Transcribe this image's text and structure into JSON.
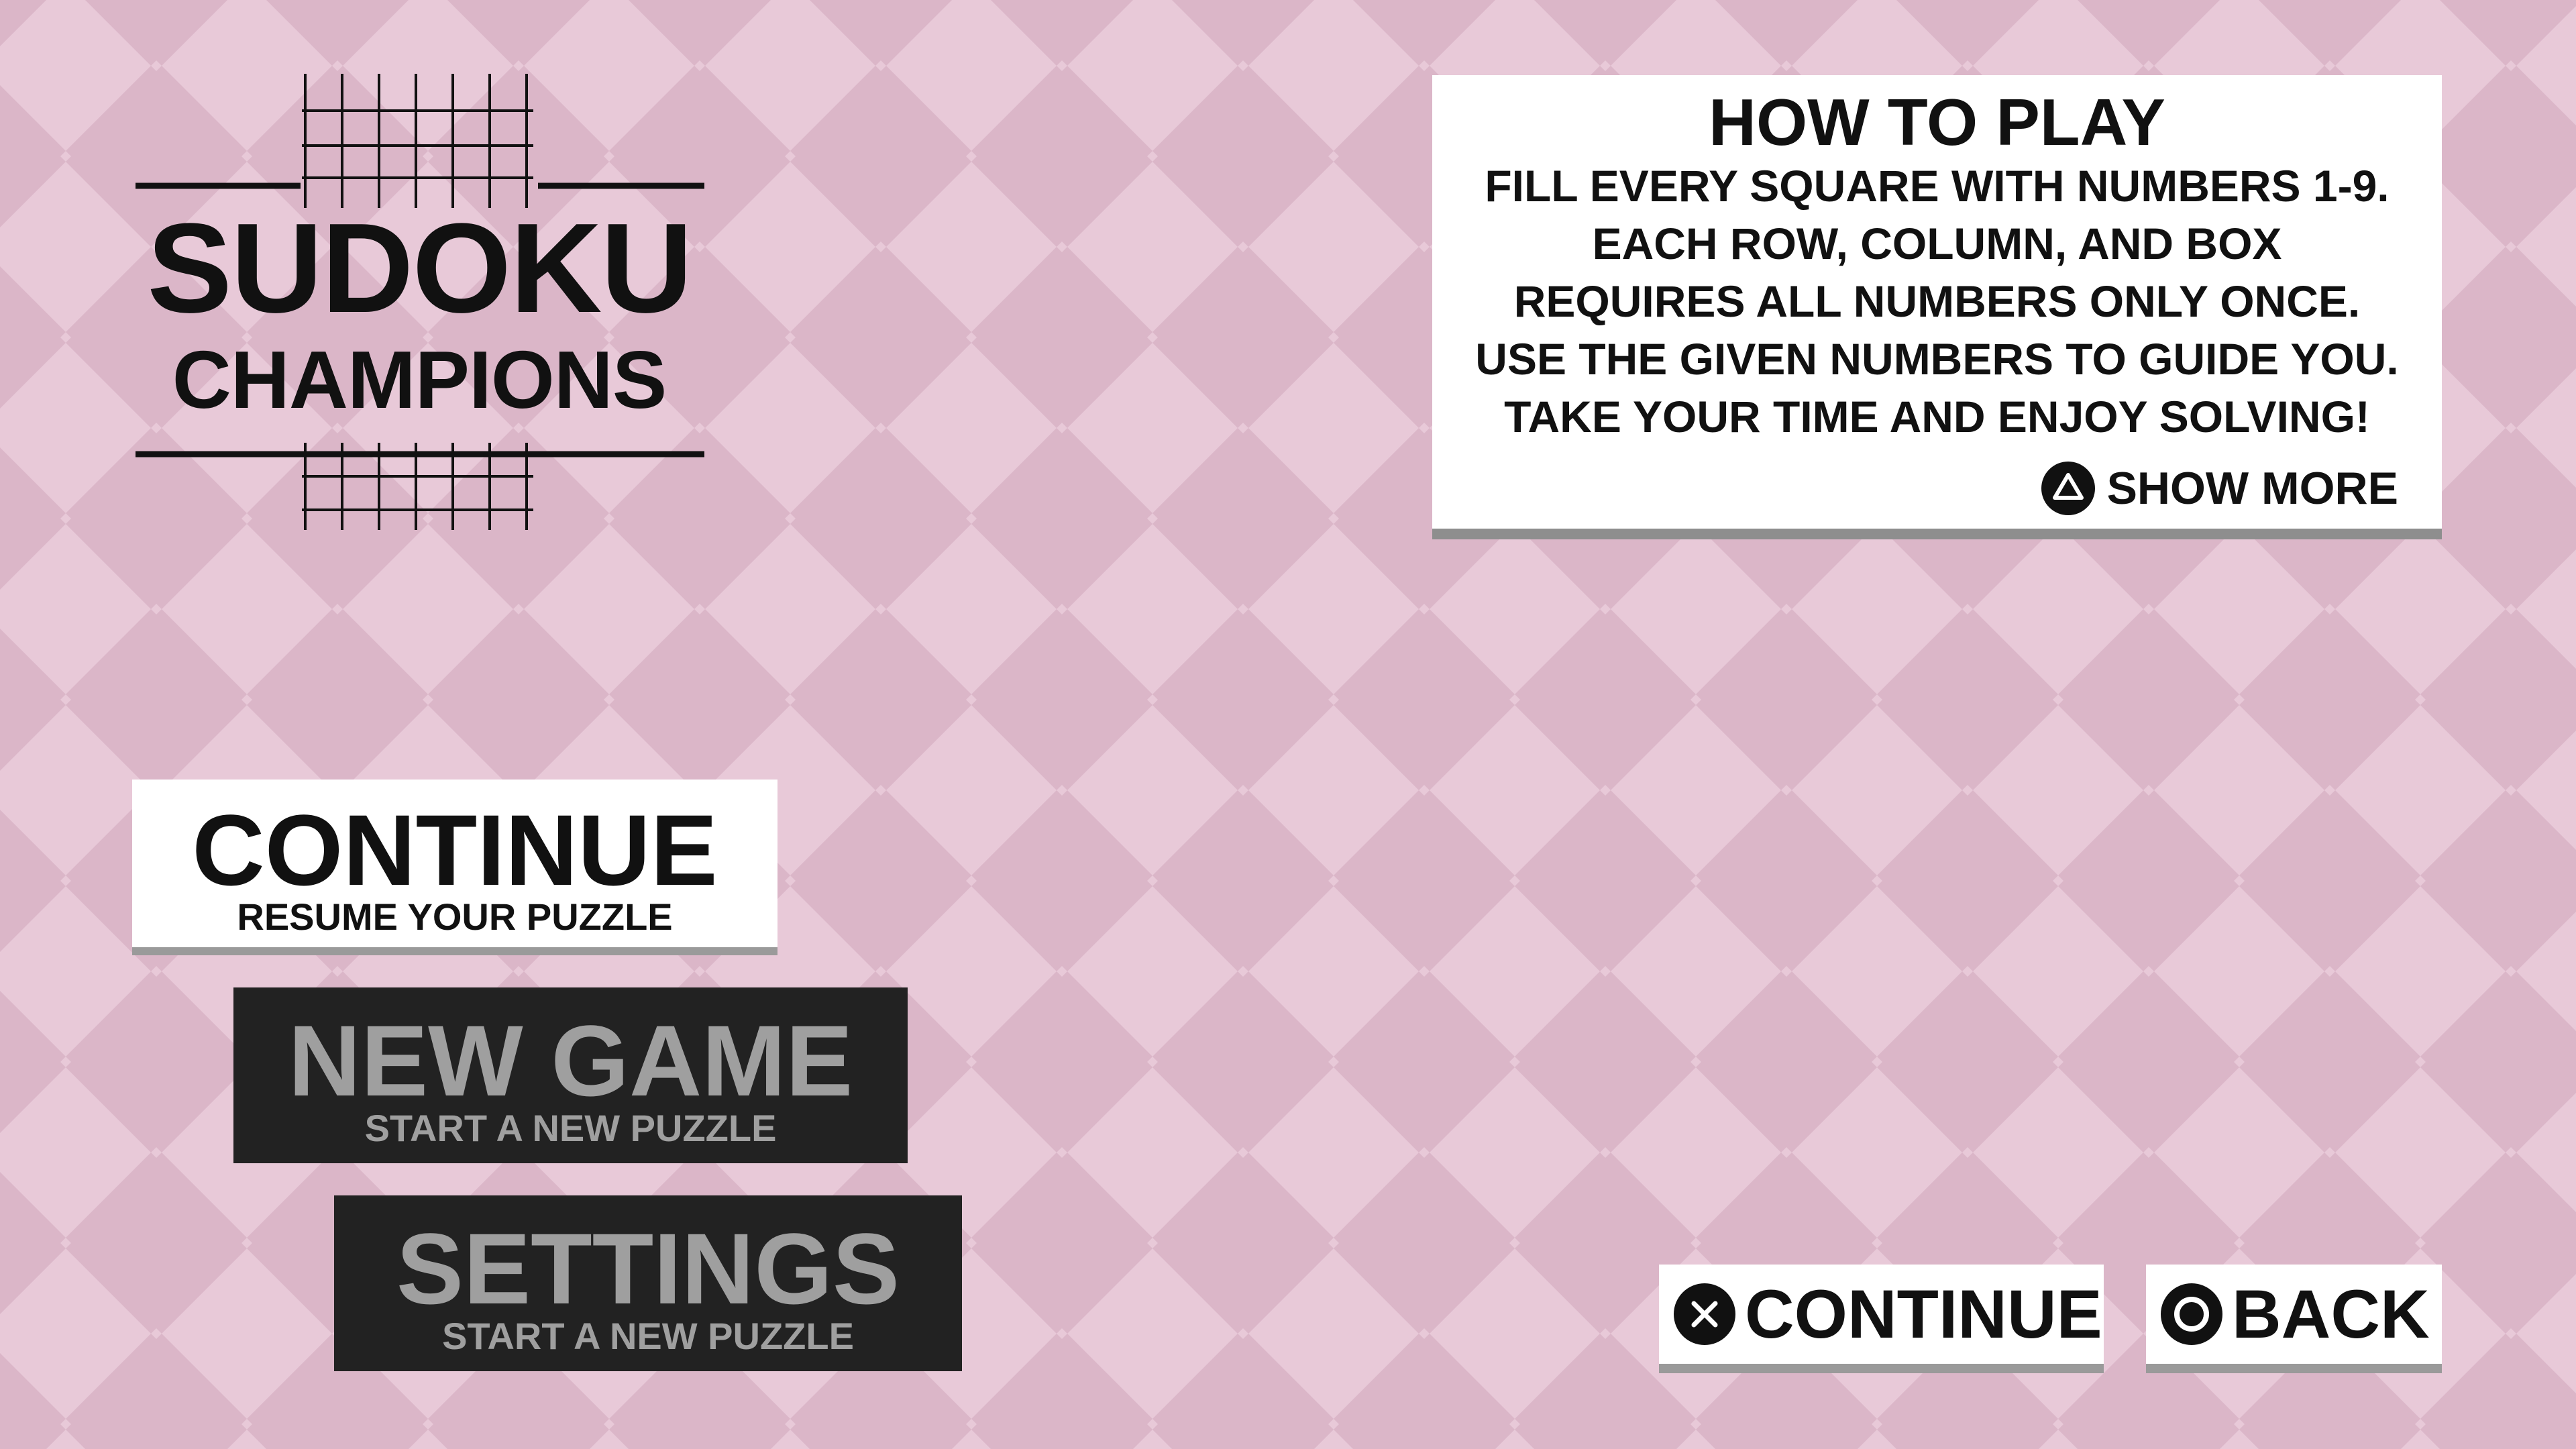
{
  "colors": {
    "background": "#dfbccd",
    "tile_light": "#e9cbd9",
    "panel": "#ffffff",
    "button_dark": "#222222",
    "button_dark_text": "#9f9f9f",
    "text": "#111111"
  },
  "logo": {
    "line1": "SUDOKU",
    "line2": "CHAMPIONS"
  },
  "how_to_play": {
    "title": "HOW TO PLAY",
    "lines": [
      "FILL EVERY SQUARE WITH NUMBERS 1-9.",
      "EACH ROW, COLUMN, AND BOX",
      "REQUIRES ALL NUMBERS ONLY ONCE.",
      "USE THE GIVEN NUMBERS TO GUIDE YOU.",
      "TAKE YOUR TIME AND ENJOY SOLVING!"
    ],
    "show_more": {
      "icon": "triangle-button-icon",
      "label": "SHOW MORE"
    }
  },
  "menu": {
    "continue": {
      "label": "CONTINUE",
      "sub": "RESUME YOUR PUZZLE",
      "selected": true
    },
    "new_game": {
      "label": "NEW GAME",
      "sub": "START A NEW PUZZLE",
      "selected": false
    },
    "settings": {
      "label": "SETTINGS",
      "sub": "START A NEW PUZZLE",
      "selected": false
    }
  },
  "prompts": {
    "continue": {
      "icon": "cross-button-icon",
      "label": "CONTINUE"
    },
    "back": {
      "icon": "circle-button-icon",
      "label": "BACK"
    }
  }
}
